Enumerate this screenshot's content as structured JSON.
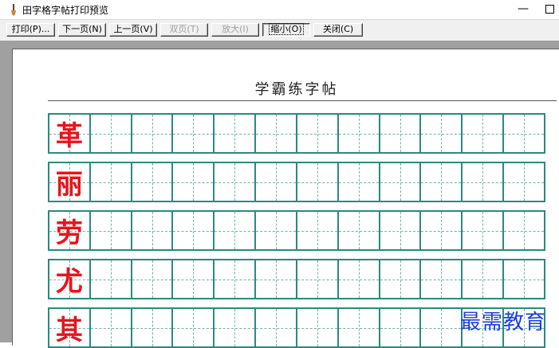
{
  "window": {
    "title": "田字格字帖打印预览",
    "minimize_glyph": "—"
  },
  "toolbar": {
    "buttons": [
      {
        "label": "打印(P)...",
        "enabled": true,
        "pressed": false
      },
      {
        "label": "下一页(N)",
        "enabled": true,
        "pressed": false
      },
      {
        "label": "上一页(V)",
        "enabled": true,
        "pressed": false
      },
      {
        "label": "双页(T)",
        "enabled": false,
        "pressed": false
      },
      {
        "label": "放大(I)",
        "enabled": false,
        "pressed": false
      },
      {
        "label": "缩小(O)",
        "enabled": true,
        "pressed": true
      },
      {
        "label": "关闭(C)",
        "enabled": true,
        "pressed": false
      }
    ]
  },
  "sheet": {
    "title": "学霸练字帖",
    "rows": [
      {
        "char": "革"
      },
      {
        "char": "丽"
      },
      {
        "char": "劳"
      },
      {
        "char": "尤"
      },
      {
        "char": "其"
      }
    ],
    "cells_per_row": 12,
    "grid_color": "#2a8a7e",
    "char_color": "#e8141e"
  },
  "watermark": "最需教育"
}
